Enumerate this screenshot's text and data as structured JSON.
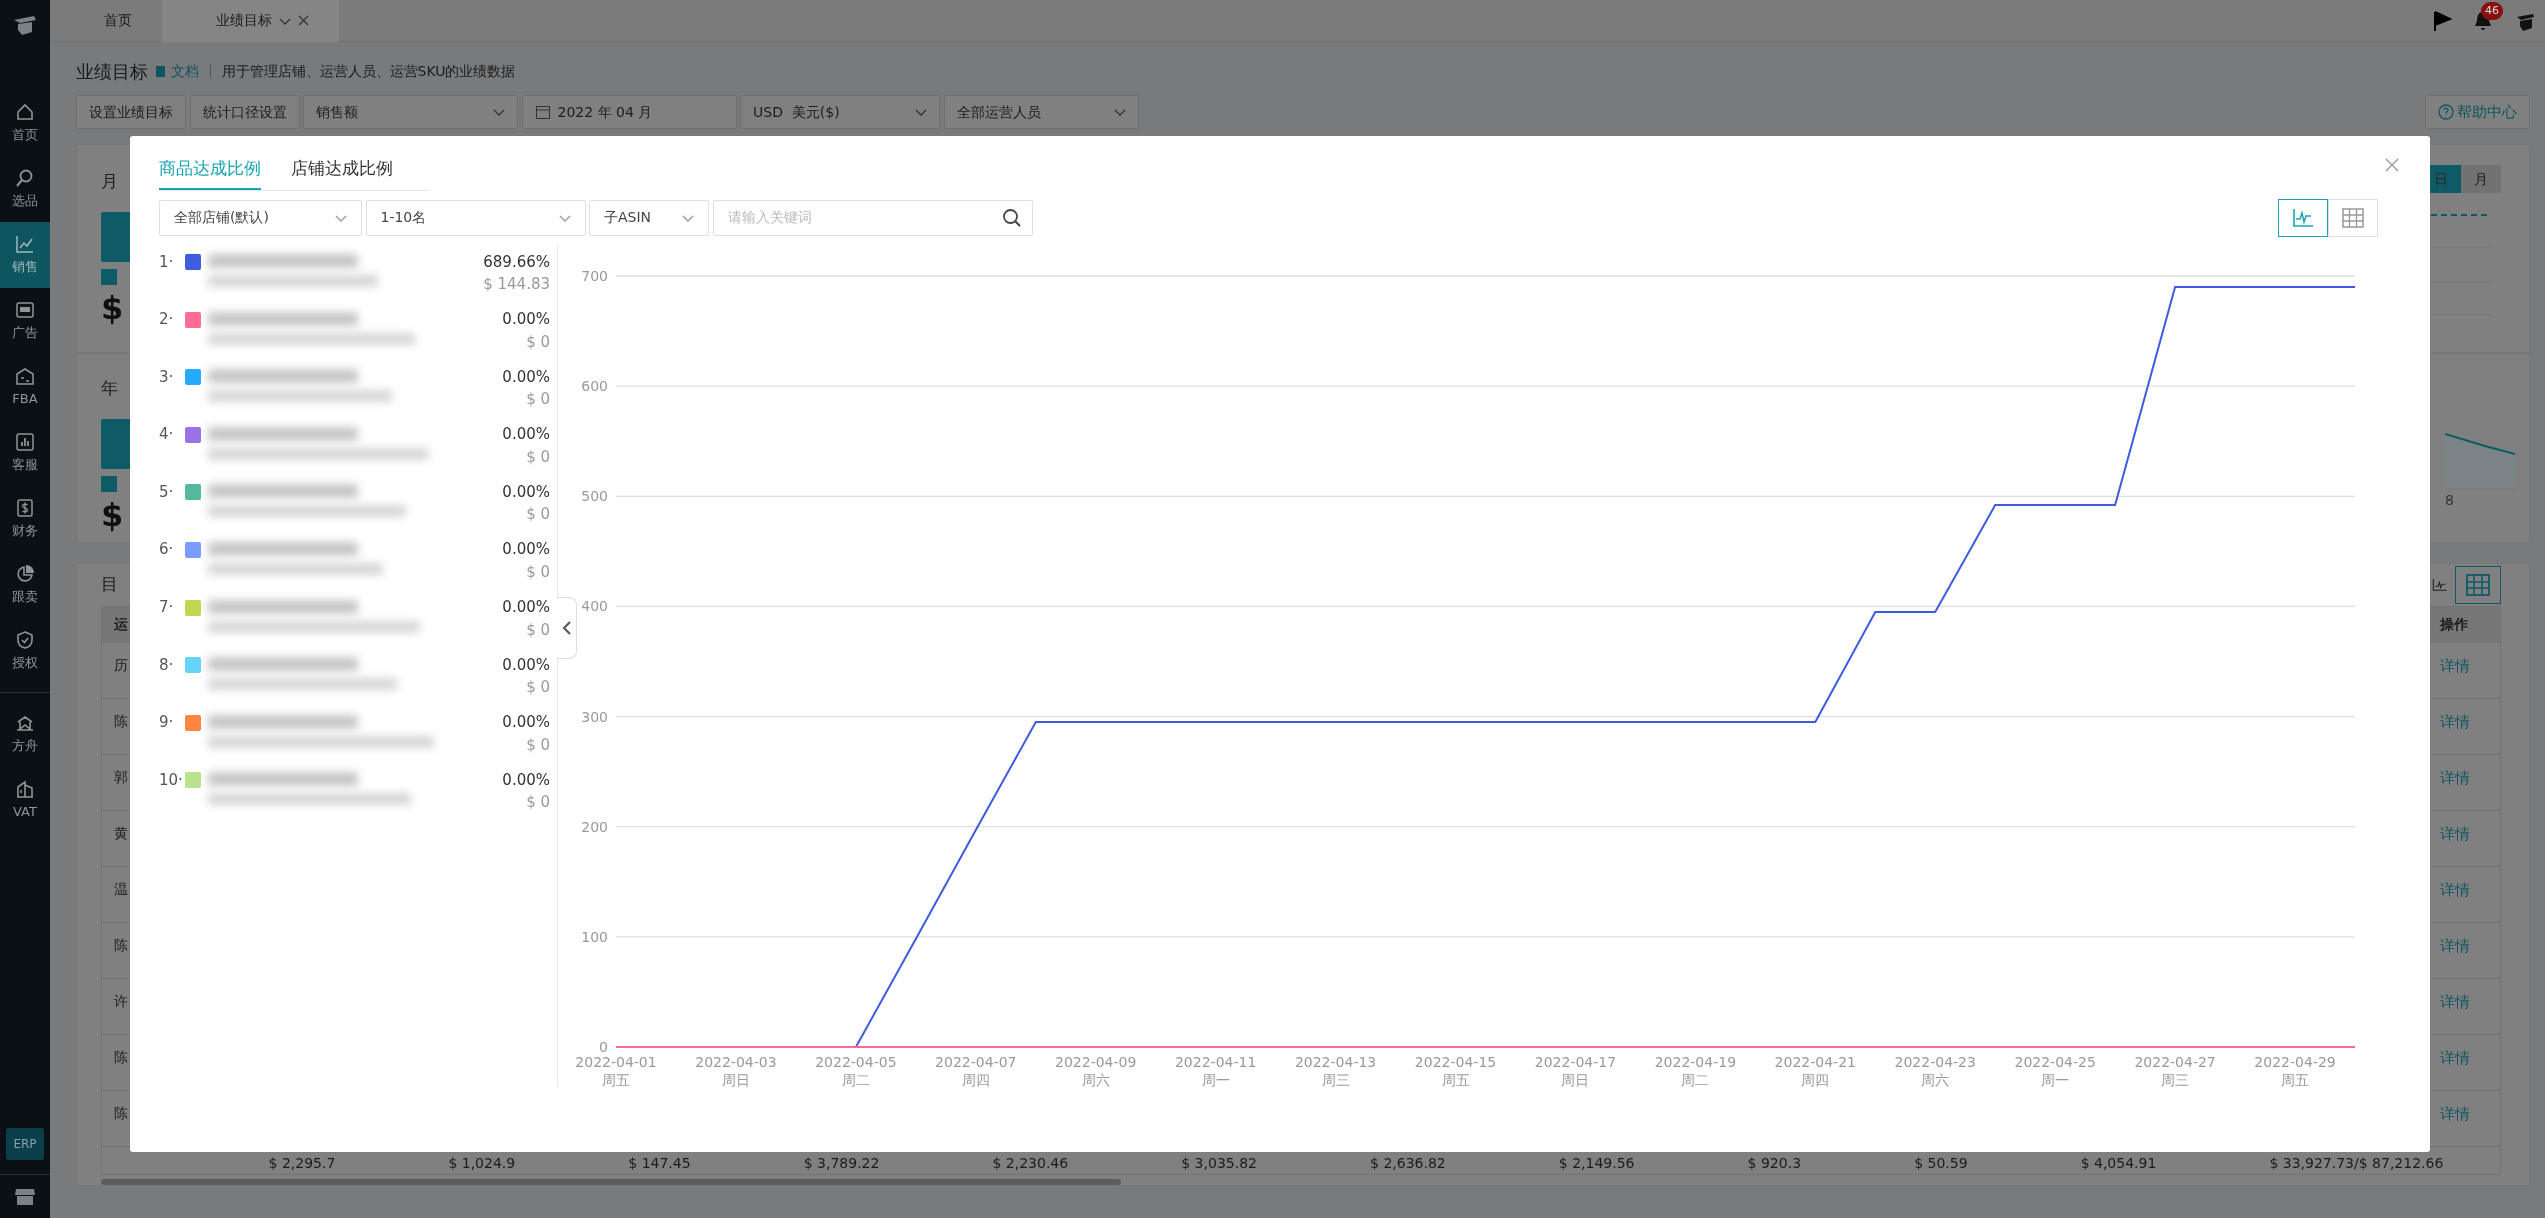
{
  "top_tabs": [
    {
      "label": "首页",
      "selected": false
    },
    {
      "label": "业绩目标",
      "selected": true
    }
  ],
  "notifications": {
    "count": "46"
  },
  "sidebar": {
    "items": [
      {
        "label": "首页",
        "selected": false
      },
      {
        "label": "选品",
        "selected": false
      },
      {
        "label": "销售",
        "selected": true
      },
      {
        "label": "广告",
        "selected": false
      },
      {
        "label": "FBA",
        "selected": false
      },
      {
        "label": "客服",
        "selected": false
      },
      {
        "label": "财务",
        "selected": false
      },
      {
        "label": "跟卖",
        "selected": false
      },
      {
        "label": "授权",
        "selected": false
      },
      {
        "label": "方舟",
        "selected": false
      },
      {
        "label": "VAT",
        "selected": false
      }
    ],
    "badge": "ERP"
  },
  "page": {
    "title": "业绩目标",
    "doc_link": "文档",
    "description": "用于管理店铺、运营人员、运营SKU的业绩数据",
    "toolbar": {
      "buttons": [
        "设置业绩目标",
        "统计口径设置"
      ],
      "metric": "销售额",
      "month": "2022 年 04 月",
      "currency": "USD  美元($)",
      "staff": "全部运营人员",
      "help": "帮助中心"
    },
    "monthly_card": {
      "title": "月",
      "amount": "$",
      "period_toggle": [
        {
          "label": "日",
          "selected": true
        },
        {
          "label": "月",
          "selected": false
        }
      ]
    },
    "yearly_card": {
      "title": "年",
      "amount": "$",
      "axis_label": "8"
    },
    "target_card": {
      "title": "目",
      "column_1": "运",
      "action_column": "操作",
      "view_toggle": [
        {
          "kind": "chart",
          "selected": false
        },
        {
          "kind": "table",
          "selected": true
        }
      ],
      "rows": [
        {
          "name": "历",
          "action": "详情"
        },
        {
          "name": "陈",
          "action": "详情"
        },
        {
          "name": "郭",
          "action": "详情"
        },
        {
          "name": "黄",
          "action": "详情"
        },
        {
          "name": "温",
          "action": "详情"
        },
        {
          "name": "陈",
          "action": "详情"
        },
        {
          "name": "许",
          "action": "详情"
        },
        {
          "name": "陈",
          "action": "详情"
        },
        {
          "name": "陈",
          "action": "详情"
        }
      ],
      "totals": [
        "$ 2,295.7",
        "$ 1,024.9",
        "$ 147.45",
        "$ 3,789.22",
        "$ 2,230.46",
        "$ 3,035.82",
        "$ 2,636.82",
        "$ 2,149.56",
        "$ 920.3",
        "$ 50.59",
        "$ 4,054.91",
        "$ 33,927.73/$ 87,212.66"
      ]
    }
  },
  "dialog": {
    "tabs": [
      {
        "label": "商品达成比例",
        "selected": true
      },
      {
        "label": "店铺达成比例",
        "selected": false
      }
    ],
    "store_filter": "全部店铺(默认)",
    "rank_filter": "1-10名",
    "asin_filter": "子ASIN",
    "search": {
      "placeholder": "请输入关键词"
    },
    "view_toggle": [
      {
        "kind": "chart",
        "selected": true
      },
      {
        "kind": "table",
        "selected": false
      }
    ],
    "items": [
      {
        "rank": "1·",
        "color": "#3d5ce0",
        "ratio": "689.66%",
        "amount": "$ 144.83"
      },
      {
        "rank": "2·",
        "color": "#ff6b94",
        "ratio": "0.00%",
        "amount": "$ 0"
      },
      {
        "rank": "3·",
        "color": "#26aaff",
        "ratio": "0.00%",
        "amount": "$ 0"
      },
      {
        "rank": "4·",
        "color": "#9a73e8",
        "ratio": "0.00%",
        "amount": "$ 0"
      },
      {
        "rank": "5·",
        "color": "#55b9a0",
        "ratio": "0.00%",
        "amount": "$ 0"
      },
      {
        "rank": "6·",
        "color": "#7a9dff",
        "ratio": "0.00%",
        "amount": "$ 0"
      },
      {
        "rank": "7·",
        "color": "#c3d650",
        "ratio": "0.00%",
        "amount": "$ 0"
      },
      {
        "rank": "8·",
        "color": "#66d4fa",
        "ratio": "0.00%",
        "amount": "$ 0"
      },
      {
        "rank": "9·",
        "color": "#ff8640",
        "ratio": "0.00%",
        "amount": "$ 0"
      },
      {
        "rank": "10·",
        "color": "#b9e38d",
        "ratio": "0.00%",
        "amount": "$ 0"
      }
    ],
    "chart_data": {
      "type": "line",
      "categories": [
        "2022-04-01 周五",
        null,
        "2022-04-03 周日",
        null,
        "2022-04-05 周二",
        null,
        "2022-04-07 周四",
        null,
        "2022-04-09 周六",
        null,
        "2022-04-11 周一",
        null,
        "2022-04-13 周三",
        null,
        "2022-04-15 周五",
        null,
        "2022-04-17 周日",
        null,
        "2022-04-19 周二",
        null,
        "2022-04-21 周四",
        null,
        "2022-04-23 周六",
        null,
        "2022-04-25 周一",
        null,
        "2022-04-27 周三",
        null,
        "2022-04-29 周五",
        null
      ],
      "series": [
        {
          "color": "#3d5ce0",
          "values": [
            null,
            null,
            null,
            null,
            0,
            98,
            197,
            295,
            295,
            295,
            295,
            295,
            295,
            295,
            295,
            295,
            295,
            295,
            295,
            295,
            295,
            395,
            395,
            492,
            492,
            492,
            690,
            690,
            690,
            690
          ]
        },
        {
          "color": "#ff6b94",
          "values": [
            0,
            0,
            0,
            0,
            0,
            0,
            0,
            0,
            0,
            0,
            0,
            0,
            0,
            0,
            0,
            0,
            0,
            0,
            0,
            0,
            0,
            0,
            0,
            0,
            0,
            0,
            0,
            0,
            0,
            0
          ]
        }
      ],
      "grid": true,
      "ylim": [
        0,
        700
      ],
      "yticks": [
        0,
        100,
        200,
        300,
        400,
        500,
        600,
        700
      ]
    }
  }
}
